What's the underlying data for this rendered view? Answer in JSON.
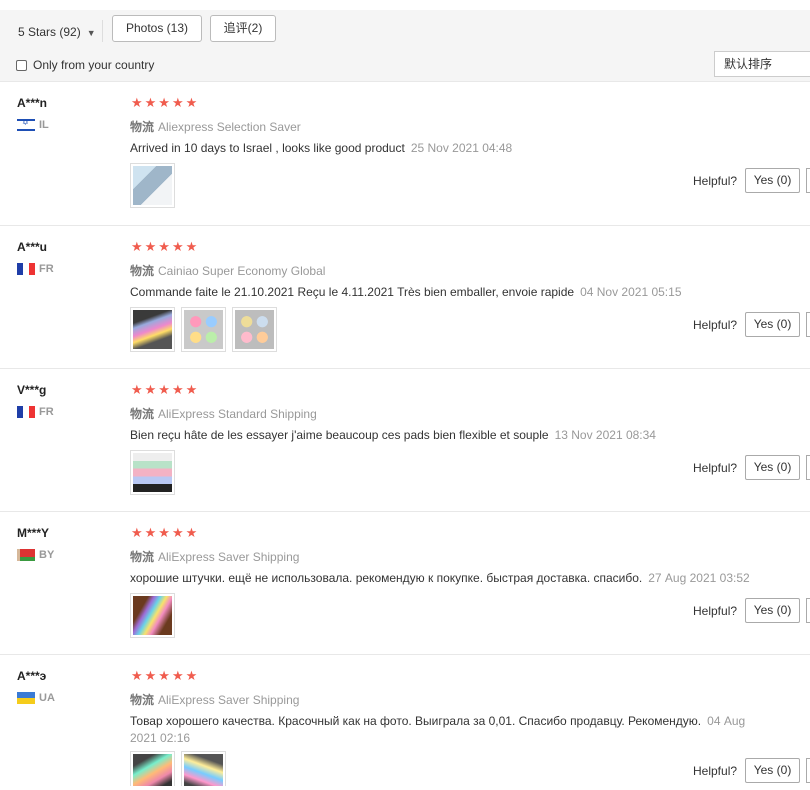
{
  "filters": {
    "star_filter": "5 Stars (92)",
    "photos_button": "Photos (13)",
    "followup_button": "追评(2)",
    "country_checkbox": "Only from your country",
    "sort_select": "默认排序"
  },
  "shipping_label": "物流",
  "helpful_label": "Helpful?",
  "reviews": [
    {
      "name": "A***n",
      "country": "IL",
      "rating": 5,
      "shipping": "Aliexpress Selection Saver",
      "text": "Arrived in 10 days to Israel , looks like good product",
      "date": "25 Nov 2021 04:48",
      "yes": "Yes (0)"
    },
    {
      "name": "A***u",
      "country": "FR",
      "rating": 4.5,
      "shipping": "Cainiao Super Economy Global",
      "text": "Commande faite le 21.10.2021 Reçu le 4.11.2021 Très bien emballer, envoie rapide",
      "date": "04 Nov 2021 05:15",
      "yes": "Yes (0)"
    },
    {
      "name": "V***g",
      "country": "FR",
      "rating": 4.5,
      "shipping": "AliExpress Standard Shipping",
      "text": "Bien reçu hâte de les essayer j'aime beaucoup ces pads bien flexible et souple",
      "date": "13 Nov 2021 08:34",
      "yes": "Yes (0)"
    },
    {
      "name": "M***Y",
      "country": "BY",
      "rating": 5,
      "shipping": "AliExpress Saver Shipping",
      "text": "хорошие штучки. ещё не использовала. рекомендую к покупке. быстрая доставка. спасибо.",
      "date": "27 Aug 2021 03:52",
      "yes": "Yes (0)"
    },
    {
      "name": "A***э",
      "country": "UA",
      "rating": 5,
      "shipping": "AliExpress Saver Shipping",
      "text": "Товар хорошего качества. Красочный как на фото. Выиграла за 0,01. Спасибо продавцу. Рекомендую.",
      "date": "04 Aug 2021 02:16",
      "yes": "Yes (0)"
    }
  ]
}
